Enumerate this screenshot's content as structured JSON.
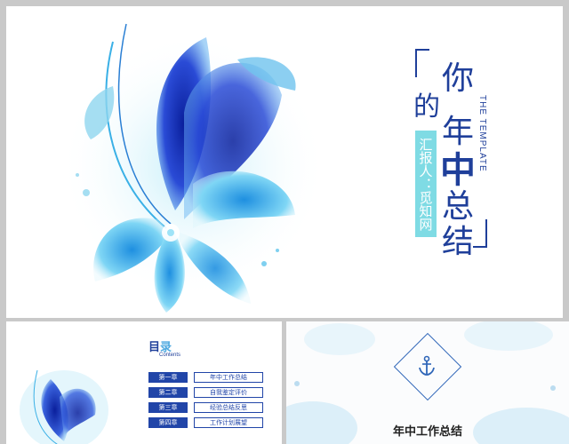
{
  "main_slide": {
    "title_chars": [
      "你",
      "的",
      "年",
      "中",
      "总",
      "结"
    ],
    "subtitle_vertical": "THE TEMPLATE",
    "reporter_label": "汇报人：觅知网"
  },
  "toc_slide": {
    "heading_mu": "目",
    "heading_lu": "录",
    "heading_en": "Contents",
    "rows": [
      {
        "chapter": "第一章",
        "item": "年中工作总结"
      },
      {
        "chapter": "第二章",
        "item": "自我鉴定评价"
      },
      {
        "chapter": "第三章",
        "item": "经验总结反思"
      },
      {
        "chapter": "第四章",
        "item": "工作计划展望"
      }
    ]
  },
  "section_slide": {
    "title": "年中工作总结",
    "icon": "anchor-icon"
  },
  "colors": {
    "accent": "#1f3f9a",
    "teal_badge": "#7fdbe4",
    "toc_blue": "#2145a8"
  }
}
